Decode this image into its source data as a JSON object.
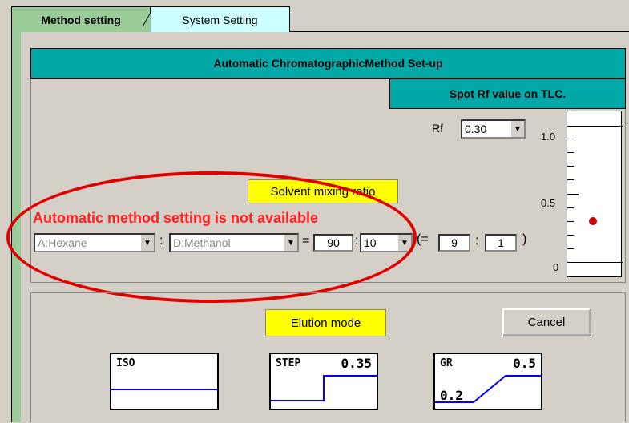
{
  "tabs": [
    {
      "label": "Method setting",
      "active": true
    },
    {
      "label": "System Setting",
      "active": false
    }
  ],
  "panel": {
    "title": "Automatic ChromatographicMethod Set-up",
    "rf_title": "Spot Rf value on TLC.",
    "rf_label": "Rf",
    "rf_value": "0.30",
    "tlc_scale": {
      "top": "1.0",
      "mid": "0.5",
      "bottom": "0"
    },
    "spot_rf": 0.3
  },
  "solvent": {
    "badge": "Solvent mixing ratio",
    "warning": "Automatic method setting is not available",
    "solvent_a": "A:Hexane",
    "sep_colon": ":",
    "solvent_b": "D:Methanol",
    "equals": "=",
    "ratio_a": "90",
    "ratio_colon": ":",
    "ratio_b": "10",
    "paren_open": "(=",
    "simple_a": "9",
    "simple_colon": ":",
    "simple_b": "1",
    "paren_close": ")"
  },
  "elution": {
    "badge": "Elution mode",
    "cancel_label": "Cancel",
    "modes": [
      {
        "label": "ISO",
        "value": "",
        "low": ""
      },
      {
        "label": "STEP",
        "value": "0.35",
        "low": ""
      },
      {
        "label": "GR",
        "value": "0.5",
        "low": "0.2"
      }
    ]
  },
  "colors": {
    "accent_teal": "#00a8a8",
    "tab_green": "#99cc99",
    "tab_cyan": "#ccffff",
    "warning_red": "#ff2020",
    "highlight_yellow": "#ffff00",
    "line_blue": "#0000ff"
  }
}
